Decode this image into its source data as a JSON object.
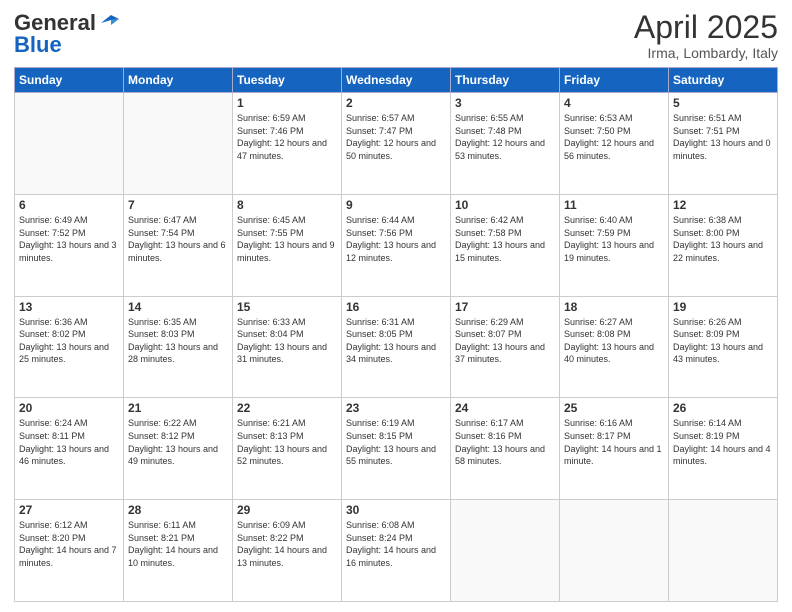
{
  "header": {
    "logo_general": "General",
    "logo_blue": "Blue",
    "title": "April 2025",
    "subtitle": "Irma, Lombardy, Italy"
  },
  "calendar": {
    "days_of_week": [
      "Sunday",
      "Monday",
      "Tuesday",
      "Wednesday",
      "Thursday",
      "Friday",
      "Saturday"
    ],
    "weeks": [
      [
        {
          "day": "",
          "info": ""
        },
        {
          "day": "",
          "info": ""
        },
        {
          "day": "1",
          "info": "Sunrise: 6:59 AM\nSunset: 7:46 PM\nDaylight: 12 hours and 47 minutes."
        },
        {
          "day": "2",
          "info": "Sunrise: 6:57 AM\nSunset: 7:47 PM\nDaylight: 12 hours and 50 minutes."
        },
        {
          "day": "3",
          "info": "Sunrise: 6:55 AM\nSunset: 7:48 PM\nDaylight: 12 hours and 53 minutes."
        },
        {
          "day": "4",
          "info": "Sunrise: 6:53 AM\nSunset: 7:50 PM\nDaylight: 12 hours and 56 minutes."
        },
        {
          "day": "5",
          "info": "Sunrise: 6:51 AM\nSunset: 7:51 PM\nDaylight: 13 hours and 0 minutes."
        }
      ],
      [
        {
          "day": "6",
          "info": "Sunrise: 6:49 AM\nSunset: 7:52 PM\nDaylight: 13 hours and 3 minutes."
        },
        {
          "day": "7",
          "info": "Sunrise: 6:47 AM\nSunset: 7:54 PM\nDaylight: 13 hours and 6 minutes."
        },
        {
          "day": "8",
          "info": "Sunrise: 6:45 AM\nSunset: 7:55 PM\nDaylight: 13 hours and 9 minutes."
        },
        {
          "day": "9",
          "info": "Sunrise: 6:44 AM\nSunset: 7:56 PM\nDaylight: 13 hours and 12 minutes."
        },
        {
          "day": "10",
          "info": "Sunrise: 6:42 AM\nSunset: 7:58 PM\nDaylight: 13 hours and 15 minutes."
        },
        {
          "day": "11",
          "info": "Sunrise: 6:40 AM\nSunset: 7:59 PM\nDaylight: 13 hours and 19 minutes."
        },
        {
          "day": "12",
          "info": "Sunrise: 6:38 AM\nSunset: 8:00 PM\nDaylight: 13 hours and 22 minutes."
        }
      ],
      [
        {
          "day": "13",
          "info": "Sunrise: 6:36 AM\nSunset: 8:02 PM\nDaylight: 13 hours and 25 minutes."
        },
        {
          "day": "14",
          "info": "Sunrise: 6:35 AM\nSunset: 8:03 PM\nDaylight: 13 hours and 28 minutes."
        },
        {
          "day": "15",
          "info": "Sunrise: 6:33 AM\nSunset: 8:04 PM\nDaylight: 13 hours and 31 minutes."
        },
        {
          "day": "16",
          "info": "Sunrise: 6:31 AM\nSunset: 8:05 PM\nDaylight: 13 hours and 34 minutes."
        },
        {
          "day": "17",
          "info": "Sunrise: 6:29 AM\nSunset: 8:07 PM\nDaylight: 13 hours and 37 minutes."
        },
        {
          "day": "18",
          "info": "Sunrise: 6:27 AM\nSunset: 8:08 PM\nDaylight: 13 hours and 40 minutes."
        },
        {
          "day": "19",
          "info": "Sunrise: 6:26 AM\nSunset: 8:09 PM\nDaylight: 13 hours and 43 minutes."
        }
      ],
      [
        {
          "day": "20",
          "info": "Sunrise: 6:24 AM\nSunset: 8:11 PM\nDaylight: 13 hours and 46 minutes."
        },
        {
          "day": "21",
          "info": "Sunrise: 6:22 AM\nSunset: 8:12 PM\nDaylight: 13 hours and 49 minutes."
        },
        {
          "day": "22",
          "info": "Sunrise: 6:21 AM\nSunset: 8:13 PM\nDaylight: 13 hours and 52 minutes."
        },
        {
          "day": "23",
          "info": "Sunrise: 6:19 AM\nSunset: 8:15 PM\nDaylight: 13 hours and 55 minutes."
        },
        {
          "day": "24",
          "info": "Sunrise: 6:17 AM\nSunset: 8:16 PM\nDaylight: 13 hours and 58 minutes."
        },
        {
          "day": "25",
          "info": "Sunrise: 6:16 AM\nSunset: 8:17 PM\nDaylight: 14 hours and 1 minute."
        },
        {
          "day": "26",
          "info": "Sunrise: 6:14 AM\nSunset: 8:19 PM\nDaylight: 14 hours and 4 minutes."
        }
      ],
      [
        {
          "day": "27",
          "info": "Sunrise: 6:12 AM\nSunset: 8:20 PM\nDaylight: 14 hours and 7 minutes."
        },
        {
          "day": "28",
          "info": "Sunrise: 6:11 AM\nSunset: 8:21 PM\nDaylight: 14 hours and 10 minutes."
        },
        {
          "day": "29",
          "info": "Sunrise: 6:09 AM\nSunset: 8:22 PM\nDaylight: 14 hours and 13 minutes."
        },
        {
          "day": "30",
          "info": "Sunrise: 6:08 AM\nSunset: 8:24 PM\nDaylight: 14 hours and 16 minutes."
        },
        {
          "day": "",
          "info": ""
        },
        {
          "day": "",
          "info": ""
        },
        {
          "day": "",
          "info": ""
        }
      ]
    ]
  }
}
